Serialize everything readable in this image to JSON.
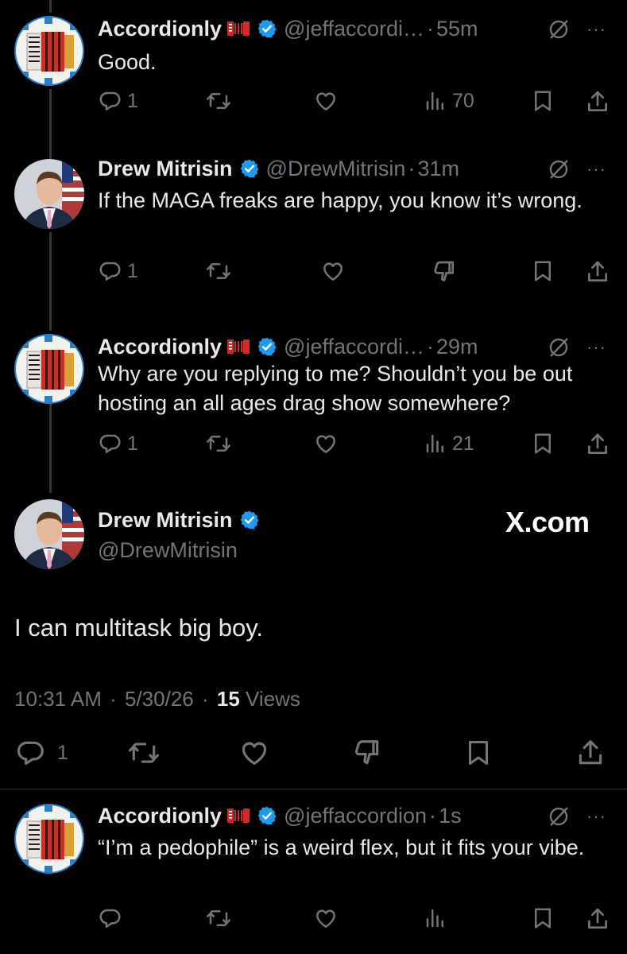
{
  "tweets": [
    {
      "name": "Accordionly",
      "handle": "@jeffaccordi…",
      "time": "55m",
      "text": "Good.",
      "replies": "1",
      "views": "70"
    },
    {
      "name": "Drew Mitrisin",
      "handle": "@DrewMitrisin",
      "time": "31m",
      "text": "If the MAGA freaks are happy, you know it’s wrong.",
      "replies": "1"
    },
    {
      "name": "Accordionly",
      "handle": "@jeffaccordi…",
      "time": "29m",
      "text": "Why are you replying to me? Shouldn’t you be out hosting an all ages drag show somewhere?",
      "replies": "1",
      "views": "21"
    }
  ],
  "main": {
    "name": "Drew Mitrisin",
    "handle": "@DrewMitrisin",
    "watermark": "X.com",
    "text": "I can multitask big boy.",
    "time": "10:31 AM",
    "date": "5/30/26",
    "views_count": "15",
    "views_label": "Views",
    "replies": "1"
  },
  "reply": {
    "name": "Accordionly",
    "handle": "@jeffaccordion",
    "time": "1s",
    "text": "“I’m a pedophile” is a weird flex, but it fits your vibe."
  },
  "separator_dot": "·",
  "more_glyph": "···",
  "icons": [
    "reply-icon",
    "retweet-icon",
    "like-icon",
    "views-icon",
    "downvote-icon",
    "bookmark-icon",
    "share-icon",
    "grok-icon",
    "verified-badge-icon",
    "accordion-emoji-icon"
  ],
  "colors": {
    "background": "#000000",
    "text": "#e7e9ea",
    "secondary": "#71767b",
    "verified": "#1d9bf0",
    "divider": "#2f3336"
  }
}
